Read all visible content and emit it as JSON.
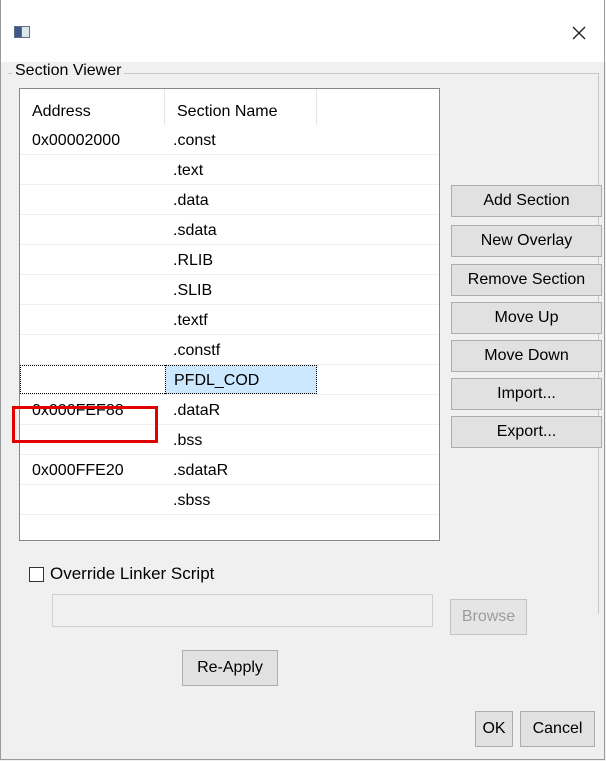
{
  "group": {
    "label": "Section Viewer"
  },
  "table": {
    "headers": [
      "Address",
      "Section Name",
      ""
    ],
    "rows": [
      {
        "address": "0x00002000",
        "name": ".const"
      },
      {
        "address": "",
        "name": ".text"
      },
      {
        "address": "",
        "name": ".data"
      },
      {
        "address": "",
        "name": ".sdata"
      },
      {
        "address": "",
        "name": ".RLIB"
      },
      {
        "address": "",
        "name": ".SLIB"
      },
      {
        "address": "",
        "name": ".textf"
      },
      {
        "address": "",
        "name": ".constf"
      },
      {
        "address": "",
        "name": "PFDL_COD",
        "selected": true
      },
      {
        "address": "0x000FEF88",
        "name": ".dataR",
        "highlighted": true
      },
      {
        "address": "",
        "name": ".bss"
      },
      {
        "address": "0x000FFE20",
        "name": ".sdataR"
      },
      {
        "address": "",
        "name": ".sbss"
      }
    ]
  },
  "side_buttons": {
    "add_section": "Add Section",
    "new_overlay": "New Overlay",
    "remove_section": "Remove Section",
    "move_up": "Move Up",
    "move_down": "Move Down",
    "import": "Import...",
    "export": "Export..."
  },
  "override": {
    "label": "Override Linker Script",
    "checked": false
  },
  "path": {
    "value": ""
  },
  "browse_label": "Browse",
  "reapply_label": "Re-Apply",
  "ok_label": "OK",
  "cancel_label": "Cancel",
  "icons": {
    "app": "window-icon",
    "close": "close-icon"
  },
  "colors": {
    "selection": "#cce8ff",
    "highlight_box": "#e00000"
  }
}
